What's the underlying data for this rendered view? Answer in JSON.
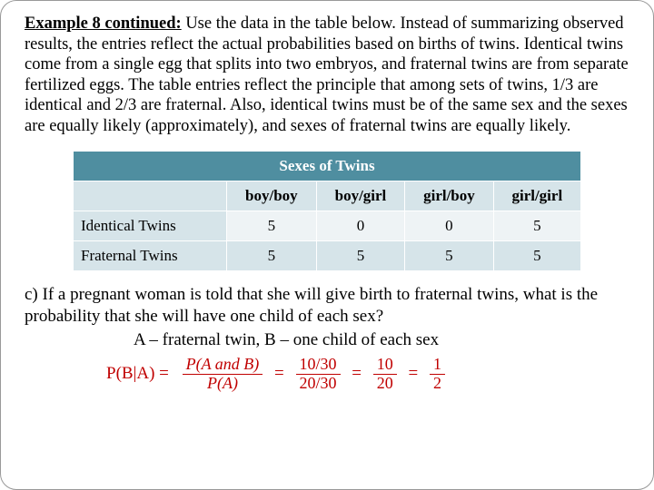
{
  "chart_data": {
    "type": "table",
    "title": "Sexes of Twins",
    "columns": [
      "boy/boy",
      "boy/girl",
      "girl/boy",
      "girl/girl"
    ],
    "rows": [
      {
        "label": "Identical Twins",
        "values": [
          5,
          0,
          0,
          5
        ]
      },
      {
        "label": "Fraternal Twins",
        "values": [
          5,
          5,
          5,
          5
        ]
      }
    ]
  },
  "intro": {
    "lead": "Example 8 continued:",
    "rest": " Use the data in the table below.  Instead of summarizing observed results, the entries reflect the actual probabilities based on births of twins.  Identical twins come from a single egg that splits into two embryos, and fraternal twins are from separate fertilized eggs.  The table entries reflect the principle that among sets of twins, 1/3 are identical and 2/3 are fraternal.  Also, identical twins must be of the same sex and the sexes are equally likely (approximately), and sexes of fraternal twins are equally likely."
  },
  "question": "c) If a  pregnant woman is told that she will give birth to fraternal twins, what is the probability that she will have one child of each sex?",
  "defs": "A – fraternal twin,   B – one child of each sex",
  "formula": {
    "lhs": "P(B|A) =",
    "f1_num": "P(A and B)",
    "f1_den": "P(A)",
    "f2_num": "10/30",
    "f2_den": "20/30",
    "f3_num": "10",
    "f3_den": "20",
    "f4_num": "1",
    "f4_den": "2"
  }
}
